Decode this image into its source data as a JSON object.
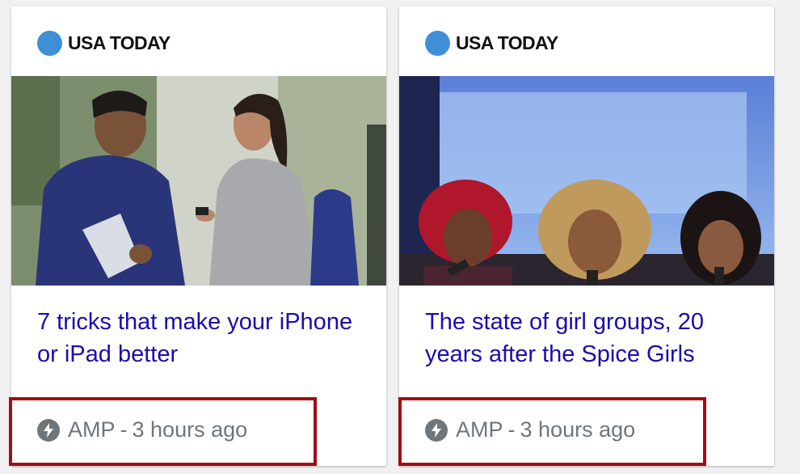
{
  "cards": [
    {
      "publisher": "USA TODAY",
      "headline": "7 tricks that make your iPhone or iPad better",
      "badge": "AMP",
      "separator": "-",
      "time": "3 hours ago"
    },
    {
      "publisher": "USA TODAY",
      "headline": "The state of girl groups, 20 years after the Spice Girls",
      "badge": "AMP",
      "separator": "-",
      "time": "3 hours ago"
    }
  ],
  "colors": {
    "publisher_dot": "#3f8fd6",
    "headline_link": "#1a0dab",
    "meta_text": "#70757a",
    "highlight_box": "#a10f14"
  },
  "icons": {
    "publisher_logo": "usa-today-blue-dot",
    "amp_badge": "amp-lightning-icon"
  }
}
